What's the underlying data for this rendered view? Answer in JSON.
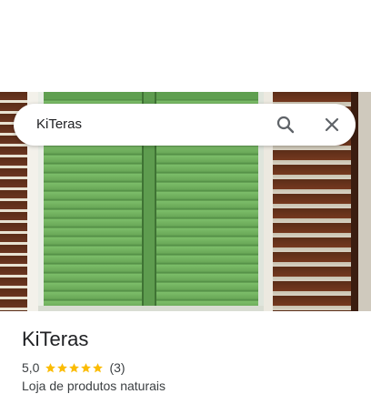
{
  "search": {
    "query": "KiTeras"
  },
  "place": {
    "name": "KiTeras",
    "rating": "5,0",
    "stars": 5,
    "review_count": "(3)",
    "category": "Loja de produtos naturais"
  },
  "colors": {
    "star": "#fbbc04",
    "text": "#202124"
  },
  "icons": {
    "search": "search-icon",
    "close": "close-icon",
    "star": "star-icon"
  }
}
